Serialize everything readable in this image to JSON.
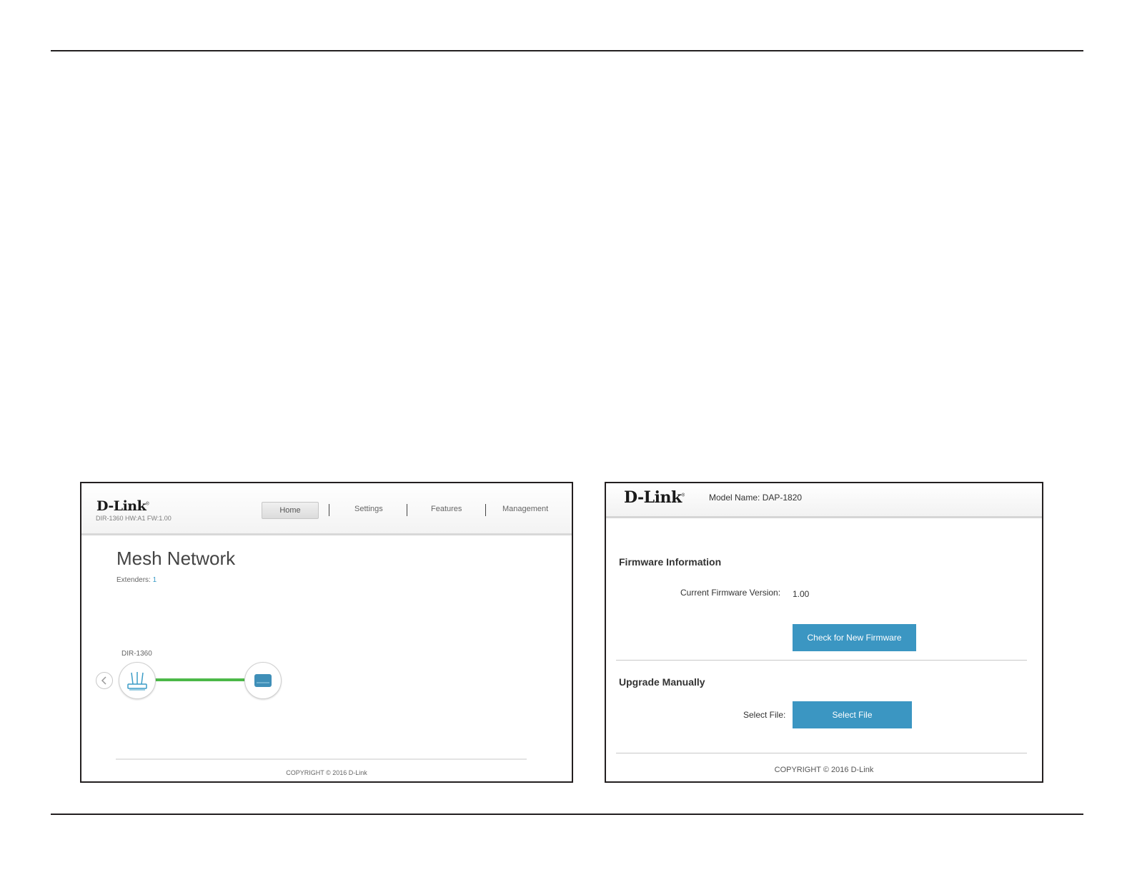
{
  "left_screenshot": {
    "logo": "D-Link",
    "model_line": "DIR-1360 HW:A1 FW:1.00",
    "nav": {
      "home": "Home",
      "settings": "Settings",
      "features": "Features",
      "management": "Management"
    },
    "page_title": "Mesh Network",
    "extenders_label": "Extenders:",
    "extenders_value": "1",
    "device_label": "DIR-1360",
    "copyright": "COPYRIGHT © 2016 D-Link",
    "colors": {
      "link_line": "#4cb848",
      "accent": "#3a9cc7"
    }
  },
  "right_screenshot": {
    "logo": "D-Link",
    "model_name": "Model Name: DAP-1820",
    "firmware_section_title": "Firmware Information",
    "current_fw_label": "Current Firmware Version:",
    "current_fw_value": "1.00",
    "check_button": "Check for New Firmware",
    "upgrade_section_title": "Upgrade Manually",
    "select_file_label": "Select File:",
    "select_file_button": "Select File",
    "copyright": "COPYRIGHT © 2016 D-Link",
    "colors": {
      "button": "#3b96c2"
    }
  }
}
